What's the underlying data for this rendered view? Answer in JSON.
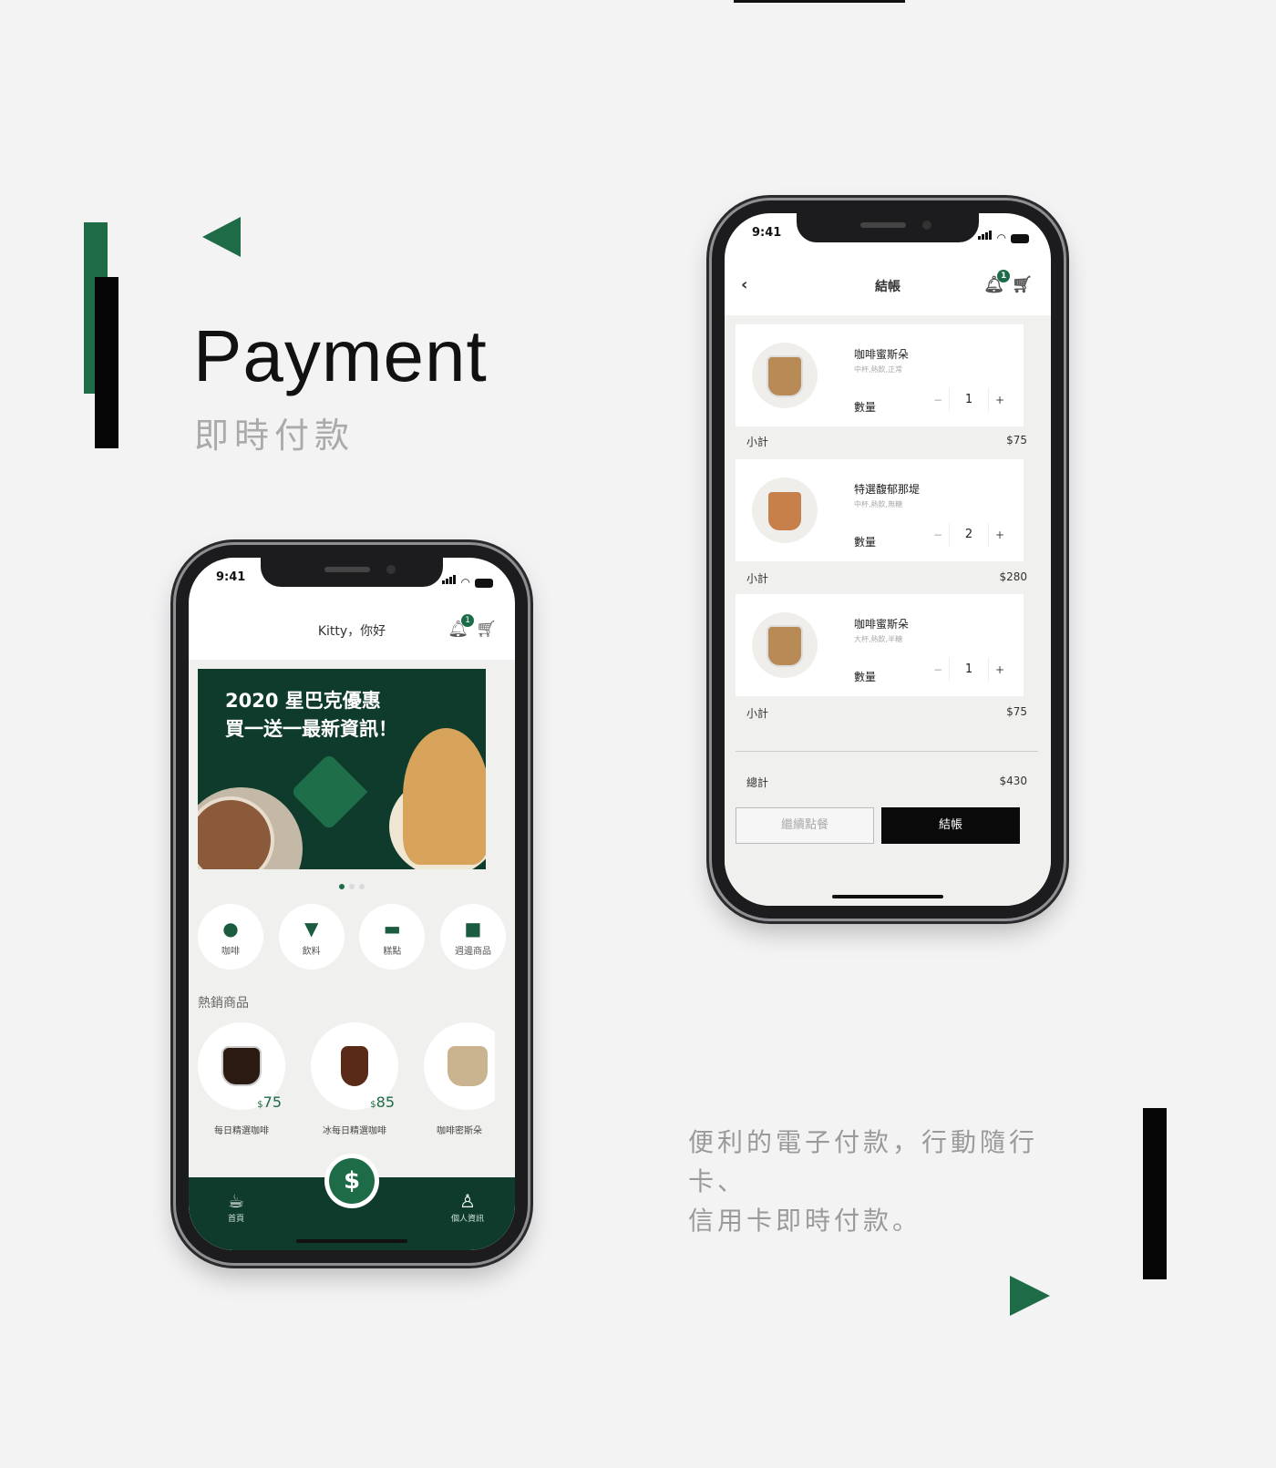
{
  "heading": {
    "title": "Payment",
    "subtitle": "即時付款"
  },
  "description": {
    "line1": "便利的電子付款，行動隨行卡、",
    "line2": "信用卡即時付款。"
  },
  "status_bar": {
    "time": "9:41"
  },
  "home_screen": {
    "greeting": "Kitty，你好",
    "notification_count": "1",
    "banner": {
      "line1": "2020 星巴克優惠",
      "line2": "買一送一最新資訊！"
    },
    "carousel": {
      "pages": 3,
      "active": 1
    },
    "categories": [
      {
        "label": "咖啡",
        "icon": "coffee-bean-icon"
      },
      {
        "label": "飲料",
        "icon": "cup-icon"
      },
      {
        "label": "糕點",
        "icon": "cake-icon"
      },
      {
        "label": "週邊商品",
        "icon": "mug-icon"
      }
    ],
    "hot_title": "熱銷商品",
    "products": [
      {
        "name": "每日精選咖啡",
        "currency": "$",
        "price": "75"
      },
      {
        "name": "冰每日精選咖啡",
        "currency": "$",
        "price": "85"
      },
      {
        "name": "咖啡密斯朵",
        "currency": "$",
        "price": ""
      }
    ],
    "tabbar": {
      "home": "首頁",
      "pay": "$",
      "profile": "個人資訊"
    }
  },
  "checkout_screen": {
    "title": "結帳",
    "notification_count": "1",
    "qty_label": "數量",
    "subtotal_label": "小計",
    "items": [
      {
        "name": "咖啡蜜斯朵",
        "options": "中杯,熱飲,正常",
        "qty": "1",
        "subtotal": "$75"
      },
      {
        "name": "特選馥郁那堤",
        "options": "中杯,熱飲,無糖",
        "qty": "2",
        "subtotal": "$280"
      },
      {
        "name": "咖啡蜜斯朵",
        "options": "大杯,熱飲,半糖",
        "qty": "1",
        "subtotal": "$75"
      }
    ],
    "total_label": "總計",
    "total": "$430",
    "continue_button": "繼續點餐",
    "pay_button": "結帳"
  },
  "colors": {
    "brand_green": "#1e6b48",
    "dark_green": "#0e3b2b",
    "black": "#050505"
  }
}
